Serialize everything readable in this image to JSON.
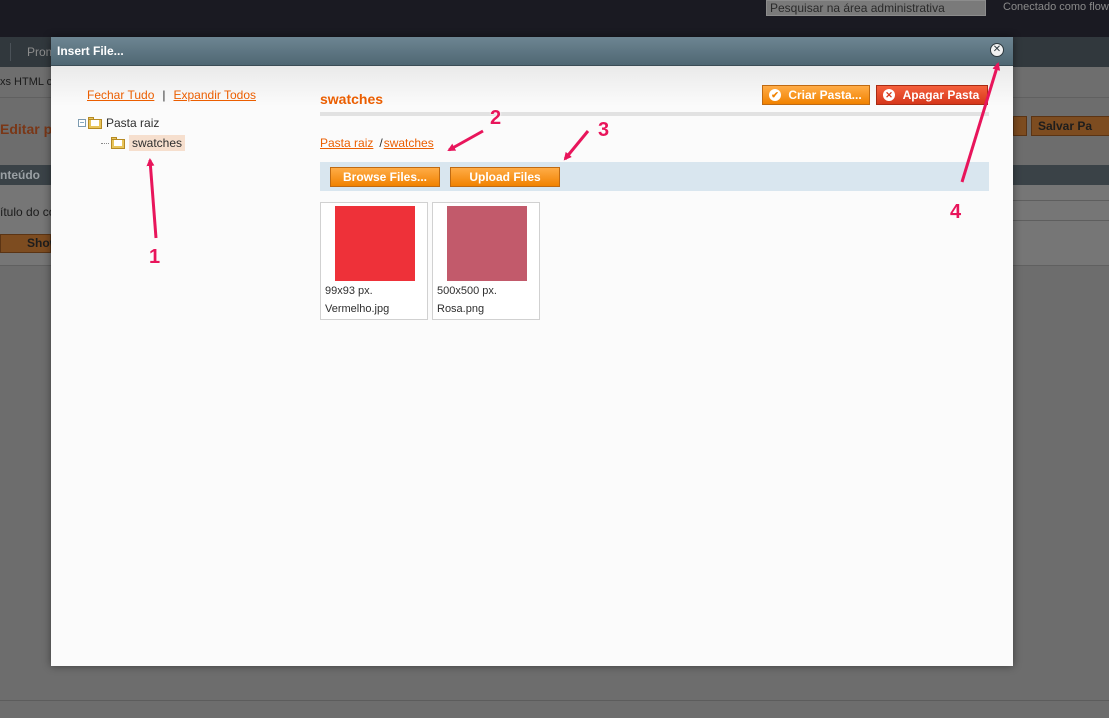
{
  "admin": {
    "search_placeholder": "Pesquisar na área administrativa",
    "connected_text": "Conectado como flow",
    "nav_item": "Prom",
    "crumb_text": "xs HTML c",
    "page_title": "Editar pa",
    "save_button": "Salvar Pa",
    "section_title": "nteúdo",
    "field_label": "ítulo do co",
    "show_button": "Show"
  },
  "modal": {
    "title": "Insert File...",
    "close_icon": "close-icon"
  },
  "tree": {
    "collapse_all": "Fechar Tudo",
    "separator": "|",
    "expand_all": "Expandir Todos",
    "root_label": "Pasta raiz",
    "child_label": "swatches"
  },
  "main": {
    "folder_heading": "swatches",
    "create_folder_button": "Criar Pasta...",
    "delete_folder_button": "Apagar Pasta",
    "breadcrumb": {
      "root": "Pasta raiz",
      "separator": "/",
      "current": "swatches"
    },
    "browse_button": "Browse Files...",
    "upload_button": "Upload Files",
    "files": [
      {
        "dimensions": "99x93 px.",
        "name": "Vermelho.jpg",
        "color": "#ee3139"
      },
      {
        "dimensions": "500x500 px.",
        "name": "Rosa.png",
        "color": "#c25a6b"
      }
    ]
  },
  "annotations": {
    "color": "#e8155b",
    "labels": [
      "1",
      "2",
      "3",
      "4"
    ]
  }
}
